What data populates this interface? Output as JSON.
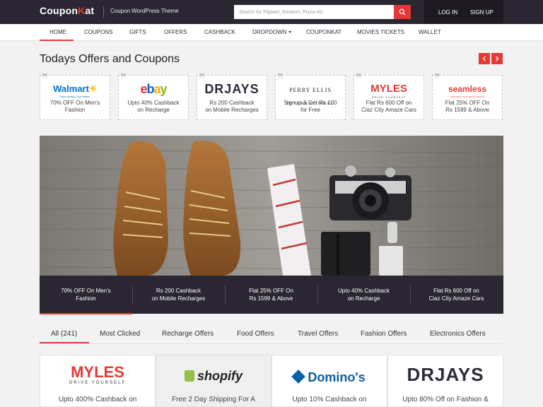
{
  "header": {
    "logo_text": "Coupon",
    "logo_k": "K",
    "logo_rest": "at",
    "tagline": "Coupon WordPress Theme",
    "search_placeholder": "Search for Flipkart, Amazon, Pizza etc.",
    "login": "LOG IN",
    "signup": "SIGN UP"
  },
  "nav": {
    "items": [
      "HOME",
      "COUPONS",
      "GIFTS",
      "OFFERS",
      "CASHBACK",
      "DROPDOWN",
      "COUPONKAT",
      "MOVIES TICKETS",
      "WALLET"
    ]
  },
  "offers_section": {
    "title": "Todays Offers and Coupons",
    "cards": [
      {
        "brand": "Walmart",
        "brand_sub": "Save money. Live better.",
        "text_1": "70% OFF On Men's",
        "text_2": "Fashion"
      },
      {
        "brand": "ebay",
        "text_1": "Upto 40% Cashback",
        "text_2": "on Recharge"
      },
      {
        "brand": "DRJAYS",
        "text_1": "Rs 200 Cashback",
        "text_2": "on Mobile Recharges"
      },
      {
        "brand_1": "PERRY ELLIS",
        "brand_2": "INTERNATIONAL",
        "text_1": "Signup & Get Rs 100",
        "text_2": "for Free"
      },
      {
        "brand": "MYLES",
        "brand_sub": "DRIVE YOURSELF",
        "text_1": "Flat Rs 600 Off on",
        "text_2": "Ciaz City Amaze Cars"
      },
      {
        "brand": "seamless",
        "brand_sub": "FAVORITE LOCAL RESTAURANTS",
        "text_1": "Flat 25% OFF On",
        "text_2": "Rs 1599 & Above"
      }
    ]
  },
  "hero_tabs": [
    {
      "line_1": "70% OFF On Men's",
      "line_2": "Fashion"
    },
    {
      "line_1": "Rs 200 Cashback",
      "line_2": "on Mobile Recharges"
    },
    {
      "line_1": "Flat 25% OFF On",
      "line_2": "Rs 1599 & Above"
    },
    {
      "line_1": "Upto 40% Cashback",
      "line_2": "on Recharge"
    },
    {
      "line_1": "Flat Rs 600 Off on",
      "line_2": "Ciaz City Amaze Cars"
    }
  ],
  "filters": [
    "All (241)",
    "Most Clicked",
    "Recharge Offers",
    "Food Offers",
    "Travel Offers",
    "Fashion Offers",
    "Electronics Offers"
  ],
  "coupons": [
    {
      "brand": "MYLES",
      "brand_sub": "DRIVE YOURSELF",
      "text": "Upto 400% Cashback on"
    },
    {
      "brand": "shopify",
      "text": "Free 2 Day Shipping For A"
    },
    {
      "brand": "Domino's",
      "text": "Upto 10% Cashback on"
    },
    {
      "brand": "DRJAYS",
      "text": "Upto 80% Off on Fashion &"
    }
  ],
  "colors": {
    "accent": "#e53935",
    "dark": "#2a2632",
    "walmart": "#0071ce",
    "dominos": "#0b5ea8",
    "shopify": "#95bf47"
  }
}
